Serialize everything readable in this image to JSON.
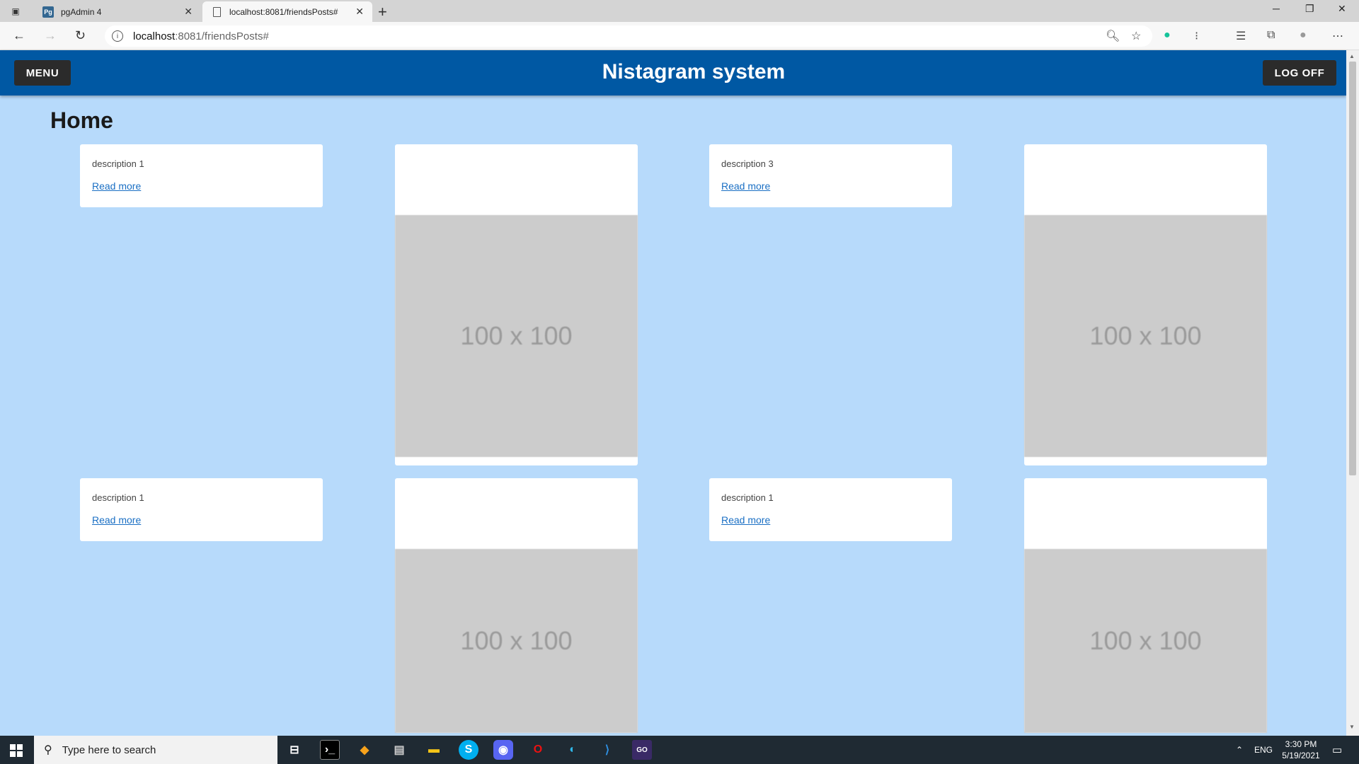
{
  "browser": {
    "tabs": [
      {
        "title": "pgAdmin 4",
        "active": false
      },
      {
        "title": "localhost:8081/friendsPosts#",
        "active": true
      }
    ],
    "url_host": "localhost",
    "url_path": ":8081/friendsPosts#"
  },
  "header": {
    "title": "Nistagram system",
    "menu_label": "MENU",
    "logoff_label": "LOG OFF",
    "color": "#0058a3"
  },
  "page": {
    "title": "Home",
    "background": "#b7dafb"
  },
  "posts": [
    {
      "description": "description 1",
      "link": "Read more"
    },
    {
      "image_label": "100 x 100"
    },
    {
      "description": "description 3",
      "link": "Read more"
    },
    {
      "image_label": "100 x 100"
    },
    {
      "description": "description 1",
      "link": "Read more"
    },
    {
      "image_label": "100 x 100"
    },
    {
      "description": "description 1",
      "link": "Read more"
    },
    {
      "image_label": "100 x 100"
    }
  ],
  "taskbar": {
    "search_placeholder": "Type here to search",
    "language": "ENG",
    "time": "3:30 PM",
    "date": "5/19/2021"
  }
}
